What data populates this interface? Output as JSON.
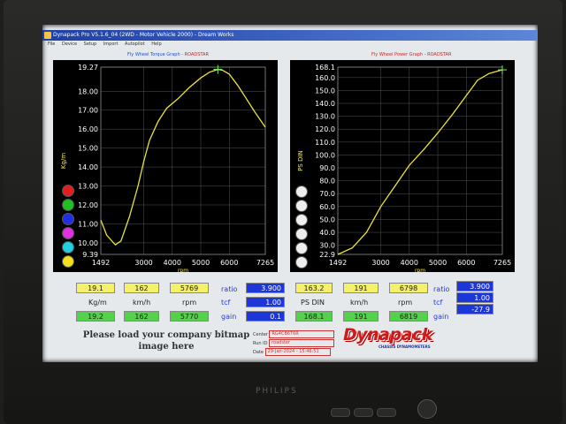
{
  "window": {
    "title": "Dynapack Pro V5.1.6_04 (2WD - Motor Vehicle 2000) - Dream Works",
    "menus": [
      "File",
      "Device",
      "Setup",
      "Import",
      "Autopilot",
      "Help"
    ]
  },
  "graphs": {
    "torque_title": "Fly Wheel Torque Graph",
    "torque_tag": "ROADSTAR",
    "power_title": "Fly Wheel Power Graph",
    "power_tag": "ROADSTAR"
  },
  "chart_data": [
    {
      "type": "line",
      "title": "Fly Wheel Torque Graph",
      "xlabel": "rpm",
      "ylabel": "Kg/m",
      "xlim": [
        1492,
        7265
      ],
      "ylim": [
        9.39,
        19.27
      ],
      "xticks": [
        "1492",
        "3000",
        "4000",
        "5000",
        "6000",
        "7265"
      ],
      "yticks": [
        "19.27",
        "18.00",
        "17.00",
        "16.00",
        "15.00",
        "14.00",
        "13.00",
        "12.00",
        "11.00",
        "10.00",
        "9.39"
      ],
      "x": [
        1492,
        1700,
        2000,
        2200,
        2500,
        2800,
        3000,
        3200,
        3500,
        3800,
        4200,
        4600,
        5000,
        5300,
        5600,
        5769,
        6000,
        6300,
        6600,
        6900,
        7265
      ],
      "y": [
        11.2,
        10.4,
        9.9,
        10.1,
        11.4,
        13.0,
        14.3,
        15.4,
        16.4,
        17.1,
        17.6,
        18.2,
        18.7,
        19.0,
        19.15,
        19.1,
        18.9,
        18.3,
        17.6,
        16.9,
        16.1
      ]
    },
    {
      "type": "line",
      "title": "Fly Wheel Power Graph",
      "xlabel": "rpm",
      "ylabel": "PS DIN",
      "xlim": [
        1492,
        7265
      ],
      "ylim": [
        22.9,
        168.1
      ],
      "xticks": [
        "1492",
        "3000",
        "4000",
        "5000",
        "6000",
        "7265"
      ],
      "yticks": [
        "168.1",
        "160.0",
        "150.0",
        "140.0",
        "130.0",
        "120.0",
        "110.0",
        "100.0",
        "90.0",
        "80.0",
        "70.0",
        "60.0",
        "50.0",
        "40.0",
        "30.0",
        "22.9"
      ],
      "x": [
        1492,
        2000,
        2500,
        3000,
        3500,
        4000,
        4500,
        5000,
        5500,
        6000,
        6400,
        6798,
        7100,
        7265
      ],
      "y": [
        22.9,
        28,
        40,
        60,
        76,
        92,
        104,
        117,
        131,
        146,
        158,
        163.2,
        165,
        166
      ]
    }
  ],
  "dots": [
    {
      "color": "#e02020"
    },
    {
      "color": "#20c020"
    },
    {
      "color": "#2030e0"
    },
    {
      "color": "#e030e0"
    },
    {
      "color": "#20d0e0"
    },
    {
      "color": "#f0e020"
    }
  ],
  "readouts_left": {
    "row1": [
      "19.1",
      "162",
      "5769"
    ],
    "units": [
      "Kg/m",
      "km/h",
      "rpm"
    ],
    "row2": [
      "19.2",
      "162",
      "5770"
    ],
    "labels": [
      "ratio",
      "tcf",
      "gain"
    ],
    "values": [
      "3.900",
      "1.00",
      "0.1"
    ]
  },
  "readouts_right": {
    "row1": [
      "163.2",
      "191",
      "6798"
    ],
    "units": [
      "PS DIN",
      "km/h",
      "rpm"
    ],
    "row2": [
      "168.1",
      "191",
      "6819"
    ],
    "labels": [
      "ratio",
      "tcf",
      "gain"
    ],
    "values": [
      "3.900",
      "1.00",
      "-27.9"
    ]
  },
  "footer": {
    "ad_text": "Please load your company bitmap image here",
    "info_labels": [
      "Center",
      "Run ID",
      "Date"
    ],
    "info_values": [
      "RG4CB6T6R",
      "roadster",
      "29-Jan-2024 - 15:46:51"
    ],
    "logo_word": "Dynapack",
    "logo_sub": "CHASSIS DYNAMOMETERS"
  },
  "monitor": {
    "brand": "PHILIPS"
  }
}
